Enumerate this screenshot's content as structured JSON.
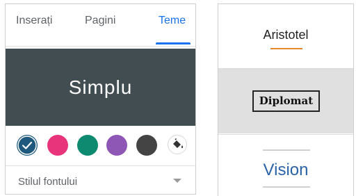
{
  "left_panel": {
    "tabs": [
      {
        "label": "Inserați",
        "active": false
      },
      {
        "label": "Pagini",
        "active": false
      },
      {
        "label": "Teme",
        "active": true
      }
    ],
    "theme_preview": {
      "title": "Simplu",
      "background": "#414d50"
    },
    "color_swatches": [
      {
        "color": "#1f5a7e",
        "selected": true
      },
      {
        "color": "#e8347a",
        "selected": false
      },
      {
        "color": "#0e8a70",
        "selected": false
      },
      {
        "color": "#8e57b5",
        "selected": false
      },
      {
        "color": "#444444",
        "selected": false
      }
    ],
    "custom_color_icon": "paint-bucket-icon",
    "font_style_select": {
      "label": "Stilul fontului",
      "icon": "caret-down-icon"
    }
  },
  "right_panel": {
    "themes": [
      {
        "name": "Aristotel",
        "accent": "#e8862a"
      },
      {
        "name": "Diplomat",
        "selected": true
      },
      {
        "name": "Vision",
        "accent": "#2b63a8"
      }
    ]
  }
}
